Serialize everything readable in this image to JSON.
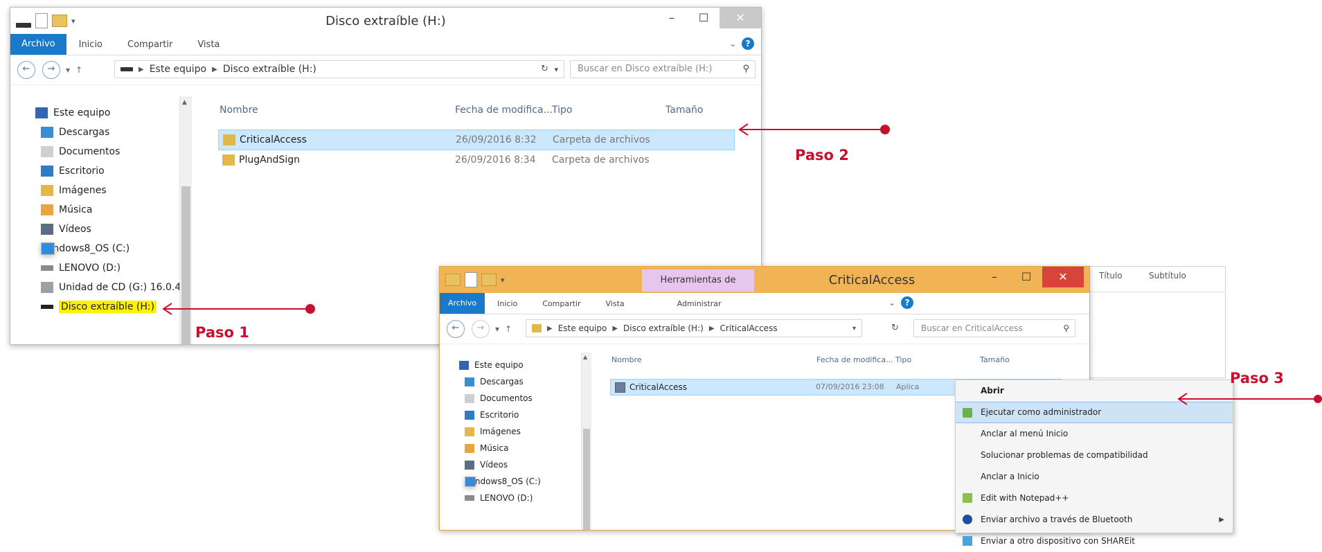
{
  "accent": "#c8102e",
  "window1": {
    "title": "Disco extraíble (H:)",
    "ribbon_tabs": [
      "Archivo",
      "Inicio",
      "Compartir",
      "Vista"
    ],
    "breadcrumb": [
      "Este equipo",
      "Disco extraíble (H:)"
    ],
    "search_placeholder": "Buscar en Disco extraíble (H:)",
    "columns": {
      "name": "Nombre",
      "date": "Fecha de modifica...",
      "type": "Tipo",
      "size": "Tamaño"
    },
    "files": [
      {
        "name": "CriticalAccess",
        "date": "26/09/2016 8:32",
        "type": "Carpeta de archivos"
      },
      {
        "name": "PlugAndSign",
        "date": "26/09/2016 8:34",
        "type": "Carpeta de archivos"
      }
    ],
    "nav_root": "Este equipo",
    "nav_items": [
      "Descargas",
      "Documentos",
      "Escritorio",
      "Imágenes",
      "Música",
      "Vídeos",
      "Windows8_OS (C:)",
      "LENOVO (D:)",
      "Unidad de CD (G:) 16.0.4",
      "Disco extraíble (H:)"
    ]
  },
  "window2": {
    "title": "CriticalAccess",
    "context_tab": "Herramientas de aplicación",
    "ribbon_tabs": [
      "Archivo",
      "Inicio",
      "Compartir",
      "Vista",
      "Administrar"
    ],
    "breadcrumb": [
      "Este equipo",
      "Disco extraíble (H:)",
      "CriticalAccess"
    ],
    "search_placeholder": "Buscar en CriticalAccess",
    "columns": {
      "name": "Nombre",
      "date": "Fecha de modifica...",
      "type": "Tipo",
      "size": "Tamaño"
    },
    "files": [
      {
        "name": "CriticalAccess",
        "date": "07/09/2016 23:08",
        "type": "Aplica"
      }
    ],
    "nav_root": "Este equipo",
    "nav_items": [
      "Descargas",
      "Documentos",
      "Escritorio",
      "Imágenes",
      "Música",
      "Vídeos",
      "Windows8_OS (C:)",
      "LENOVO (D:)"
    ]
  },
  "context_menu": [
    {
      "label": "Abrir",
      "bold": true
    },
    {
      "label": "Ejecutar como administrador",
      "highlight": true
    },
    {
      "label": "Anclar al menú Inicio"
    },
    {
      "label": "Solucionar problemas de compatibilidad"
    },
    {
      "label": "Anclar a Inicio"
    },
    {
      "label": "Edit with Notepad++"
    },
    {
      "label": "Enviar archivo a través de Bluetooth",
      "submenu": true
    },
    {
      "label": "Enviar a otro dispositivo con SHAREit"
    }
  ],
  "background_window": {
    "col1": "Título",
    "col2": "Subtítulo"
  },
  "annotations": {
    "step1": "Paso 1",
    "step2": "Paso 2",
    "step3": "Paso 3"
  }
}
